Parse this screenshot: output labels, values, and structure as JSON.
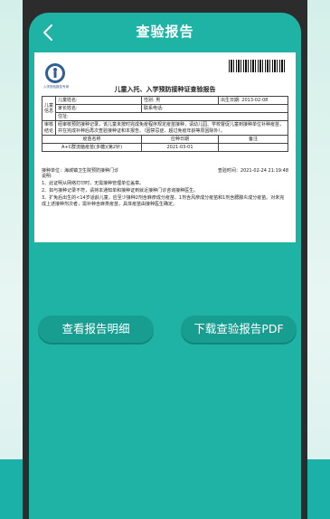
{
  "header": {
    "title": "查验报告"
  },
  "document": {
    "logo_text": "入学查验报告专用",
    "title": "儿童入托、入学预防接种证查验报告",
    "section_label": "儿童信息",
    "fields": {
      "name_label": "儿童姓名:",
      "gender": "性别: 男",
      "birth": "出生日期: 2013-02-08",
      "parent_label": "家长姓名:",
      "phone_label": "联系电话:",
      "address_label": "住址:"
    },
    "conclusion_label": "审核结论",
    "conclusion_text": "经审核预防接种记录，该儿童未按时完成免疫程序规定疫苗接种，请幼儿园、学校督促儿童到接种单位补种疫苗，并在完成补种后再次查验接种证和本报告。（因禁忌症、超过免疫年龄等原因除外）。",
    "table_headers": [
      "疫苗名称",
      "应种日期",
      "备注"
    ],
    "table_rows": [
      {
        "vaccine": "A+C群流脑疫苗(多糖)(第2针)",
        "date": "2021-03-01",
        "note": ""
      }
    ],
    "clinic": "接种单位：海城镇卫生院预防接种门诊",
    "check_time": "查验时间：2021-02-24 21:19:48",
    "notes_title": "说明:",
    "notes": [
      "1、此证明从网络打印时，无需接种管理单位盖章。",
      "2、如与接种记录不符，请持本通知单和接种证到就近接种门诊咨询接种医生。",
      "3、扩免后出生的<14岁适龄儿童，应至少接种2剂含麻疹成分疫苗、1剂含风疹成分疫苗和1剂含腮腺炎成分疫苗。对未完成上述接种剂次者，需补种含麻类疫苗，具体疫苗由接种医生确定。"
    ]
  },
  "buttons": {
    "view_detail": "查看报告明细",
    "download_pdf": "下载查验报告PDF"
  },
  "colors": {
    "primary": "#1fb3a5",
    "button": "#189d91"
  }
}
